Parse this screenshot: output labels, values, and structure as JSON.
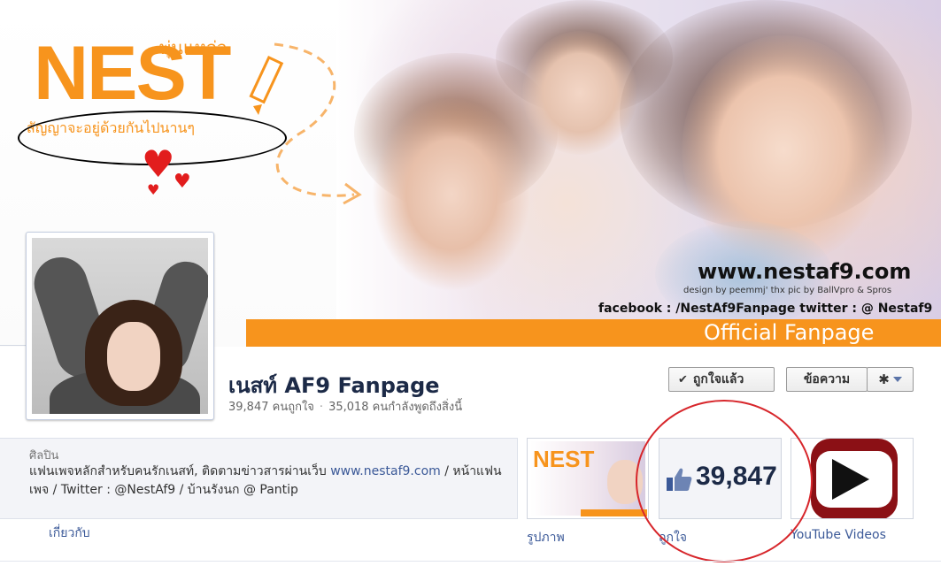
{
  "cover": {
    "logo_main": "NEST",
    "logo_small": "พุ่นแหล่ว",
    "logo_tagline": "สัญญาจะอยู่ด้วยกันไปนานๆ",
    "website": "www.nestaf9.com",
    "design_credit": "design by peemmj' thx pic by BallVpro & Spros",
    "facebook_line": "facebook : /NestAf9Fanpage  twitter : @ Nestaf9",
    "banner_text": "Official  Fanpage",
    "accent_color": "#f7941d"
  },
  "page": {
    "title": "เนสท์ AF9 Fanpage",
    "likes_text": "39,847 คนถูกใจ",
    "talking_text": "35,018 คนกำลังพูดถึงสิ่งนี้",
    "separator": "·"
  },
  "actions": {
    "liked_label": "ถูกใจแล้ว",
    "message_label": "ข้อความ",
    "gear_icon": "gear-icon"
  },
  "about": {
    "category": "ศิลปิน",
    "description_before": "แฟนเพจหลักสำหรับคนรักเนสท์, ติดตามข่าวสารผ่านเว็บ ",
    "description_link": "www.nestaf9.com",
    "description_after": " / หน้าแฟนเพจ / Twitter : @NestAf9 / บ้านรังนก @ Pantip",
    "link_label": "เกี่ยวกับ"
  },
  "apps": [
    {
      "label": "รูปภาพ",
      "thumb_text": "NEST"
    },
    {
      "label": "ถูกใจ",
      "count": "39,847"
    },
    {
      "label": "YouTube Videos"
    }
  ],
  "annotations": {
    "circle_color": "#d7262b"
  }
}
